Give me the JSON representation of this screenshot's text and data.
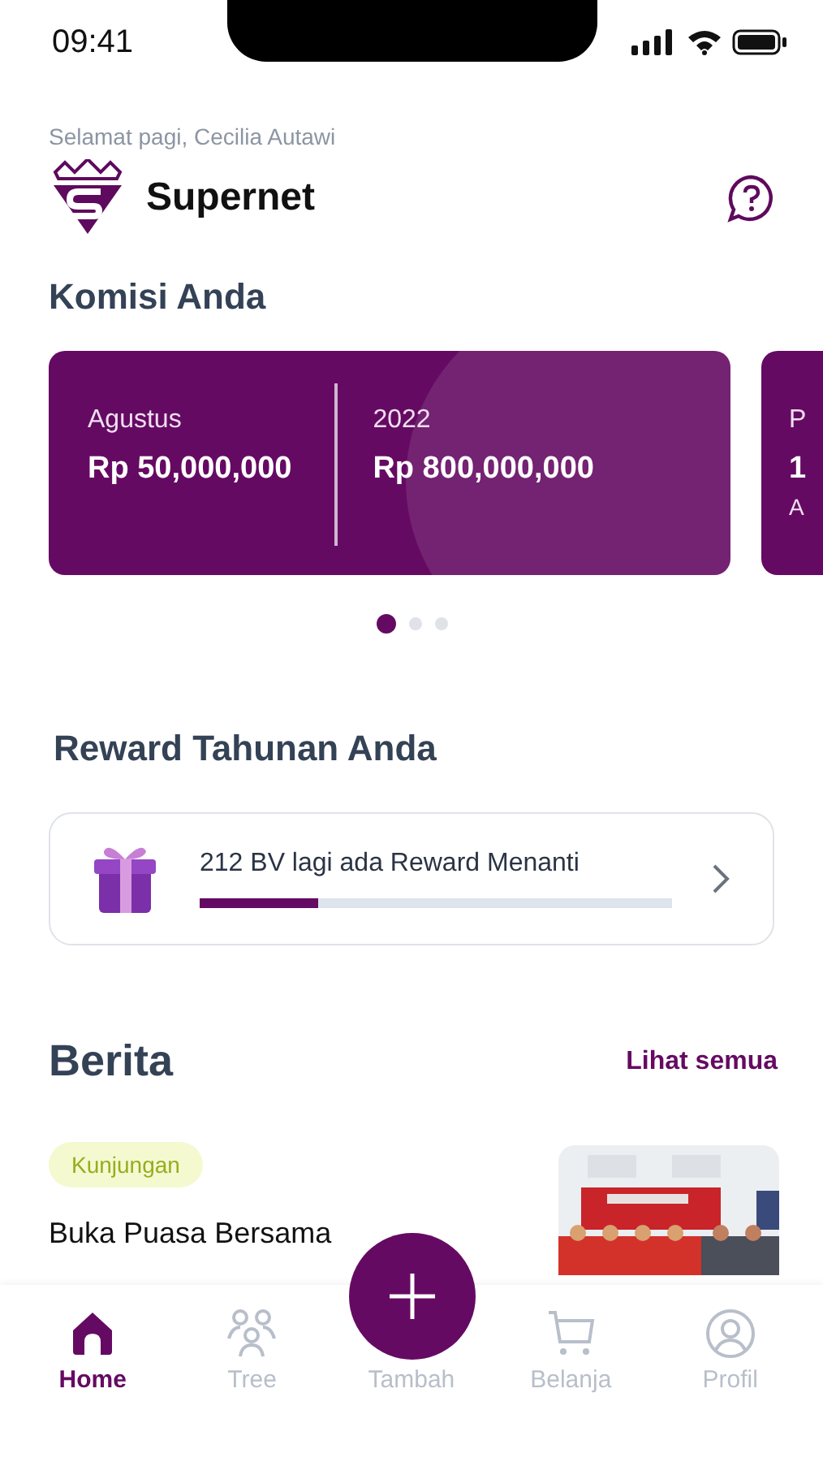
{
  "status_bar": {
    "time": "09:41"
  },
  "greeting": "Selamat pagi, Cecilia Autawi",
  "brand": {
    "name": "Supernet"
  },
  "commission": {
    "title": "Komisi Anda",
    "cards": [
      {
        "kind": "split",
        "columns": [
          {
            "label": "Agustus",
            "value": "Rp 50,000,000"
          },
          {
            "label": "2022",
            "value": "Rp 800,000,000"
          }
        ]
      },
      {
        "kind": "single",
        "label": "P",
        "value": "1",
        "note": "A"
      }
    ],
    "dots": [
      {
        "selected": true
      },
      {
        "selected": false
      },
      {
        "selected": false
      }
    ]
  },
  "reward": {
    "title": "Reward Tahunan Anda",
    "text": "212 BV lagi ada Reward Menanti",
    "level": 0.25
  },
  "news": {
    "title": "Berita",
    "link": "Lihat semua",
    "items": [
      {
        "tag": "Kunjungan",
        "title": "Buka Puasa Bersama",
        "kind": "picture"
      }
    ]
  },
  "nav": [
    {
      "kind": "home",
      "label": "Home",
      "selected": true
    },
    {
      "kind": "tree",
      "label": "Tree",
      "selected": false
    },
    {
      "kind": "add",
      "label": "Tambah",
      "selected": false
    },
    {
      "kind": "cart",
      "label": "Belanja",
      "selected": false
    },
    {
      "kind": "profile",
      "label": "Profil",
      "selected": false
    }
  ]
}
